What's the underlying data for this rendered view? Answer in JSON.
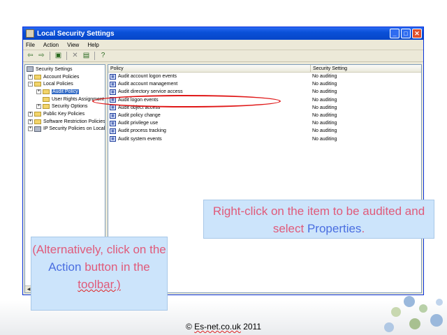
{
  "window": {
    "title": "Local Security Settings",
    "menu": [
      "File",
      "Action",
      "View",
      "Help"
    ]
  },
  "toolbar": {
    "icons": [
      "back-arrow-icon",
      "forward-arrow-icon",
      "up-folder-icon",
      "delete-icon",
      "properties-icon",
      "help-icon"
    ]
  },
  "tree": {
    "root": "Security Settings",
    "account_policies": "Account Policies",
    "local_policies": "Local Policies",
    "audit_policy": "Audit Policy",
    "user_rights": "User Rights Assignment",
    "security_options": "Security Options",
    "public_key": "Public Key Policies",
    "software_restriction": "Software Restriction Policies",
    "ip_security": "IP Security Policies on Local"
  },
  "list": {
    "header_policy": "Policy",
    "header_setting": "Security Setting",
    "rows": [
      {
        "name": "Audit account logon events",
        "setting": "No auditing"
      },
      {
        "name": "Audit account management",
        "setting": "No auditing"
      },
      {
        "name": "Audit directory service access",
        "setting": "No auditing"
      },
      {
        "name": "Audit logon events",
        "setting": "No auditing"
      },
      {
        "name": "Audit object access",
        "setting": "No auditing"
      },
      {
        "name": "Audit policy change",
        "setting": "No auditing"
      },
      {
        "name": "Audit privilege use",
        "setting": "No auditing"
      },
      {
        "name": "Audit process tracking",
        "setting": "No auditing"
      },
      {
        "name": "Audit system events",
        "setting": "No auditing"
      }
    ]
  },
  "callouts": {
    "right_text_a": "Right-click on the item to be audited and select ",
    "right_highlight": "Properties",
    "right_text_b": ".",
    "left_text_a": "(Alternatively, click on the ",
    "left_highlight": "Action",
    "left_text_b": " button in the ",
    "left_text_c": "toolbar.)"
  },
  "footer": {
    "prefix": "© ",
    "brand": "Es-net.co.uk",
    "year": " 2011"
  },
  "colors": {
    "callout_text": "#e05a7a",
    "callout_highlight": "#4a6ee0",
    "callout_bg": "#cce4fb",
    "ellipse": "#e01818",
    "titlebar": "#0a50d8"
  }
}
